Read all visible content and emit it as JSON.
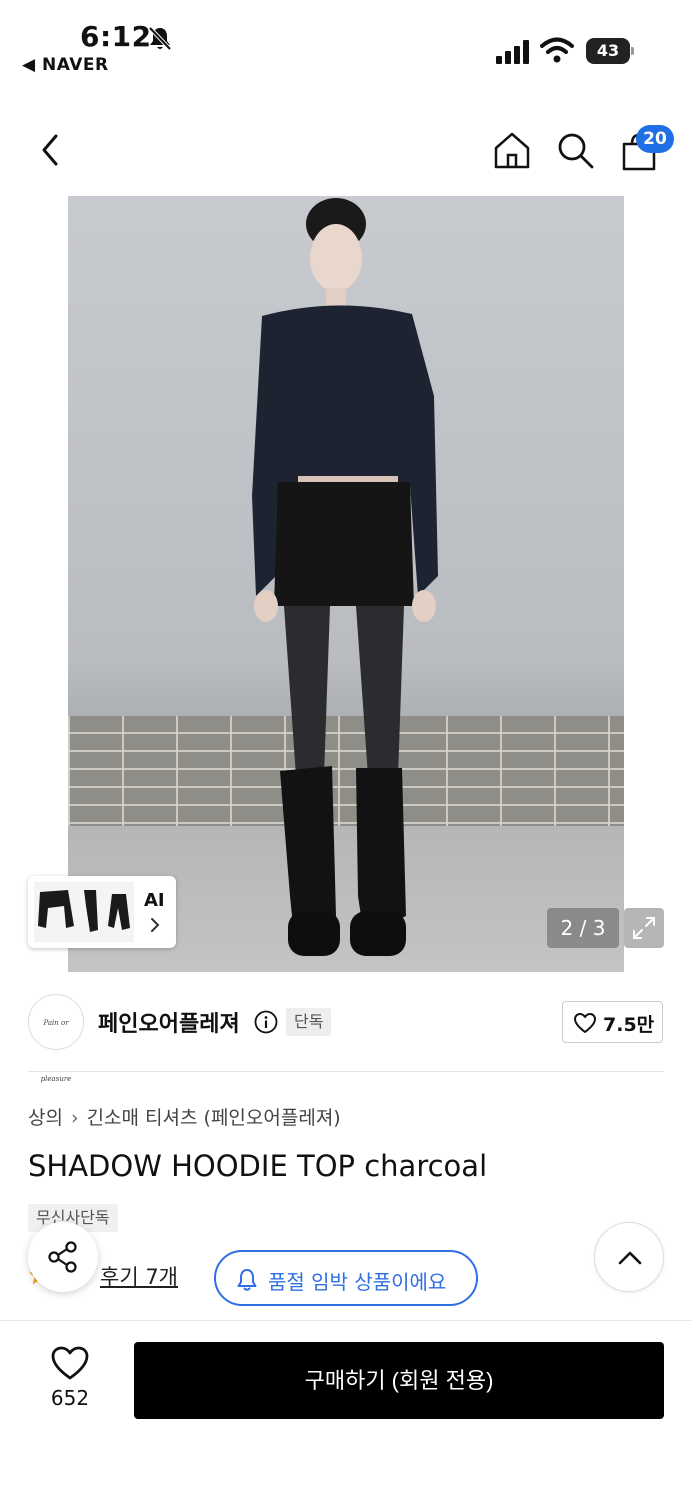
{
  "status_bar": {
    "time": "6:12",
    "back_app": "◀ NAVER",
    "battery": "43"
  },
  "header": {
    "cart_count": "20"
  },
  "gallery": {
    "ai_label": "AI",
    "pager": "2 / 3"
  },
  "brand": {
    "logo_text": "Pain or pleasure",
    "name": "페인오어플레져",
    "tag": "단독",
    "likes": "7.5만"
  },
  "breadcrumb": {
    "category": "상의",
    "subcategory": "긴소매 티셔츠 (페인오어플레져)"
  },
  "product": {
    "title": "SHADOW HOODIE TOP charcoal",
    "badge": "무신사단독",
    "review_link": "후기 7개",
    "soldout_notice": "품절 임박 상품이에요"
  },
  "bottom_bar": {
    "wish_count": "652",
    "buy_label": "구매하기 (회원 전용)"
  },
  "colors": {
    "accent_blue": "#2f6fe6",
    "badge_blue": "#1f6fe5",
    "buy_button": "#000000"
  }
}
